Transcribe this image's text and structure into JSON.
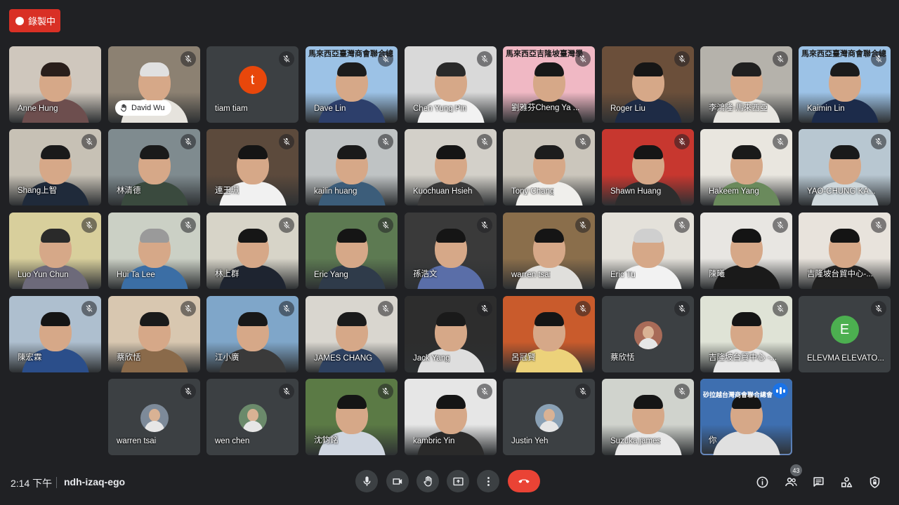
{
  "recording": {
    "label": "錄製中"
  },
  "participants": [
    {
      "name": "Anne Hung",
      "muted": false,
      "bg": "#cfc7bd",
      "shirt": "#6d4e4e",
      "hair": "#2a1f1b"
    },
    {
      "name": "David Wu",
      "muted": true,
      "bg": "#8c8172",
      "shirt": "#e6e3dd",
      "hair": "#e0e0e0",
      "hand_raised": true
    },
    {
      "name": "tiam tiam",
      "muted": true,
      "avatar": "t",
      "avatar_color": "#e8470b"
    },
    {
      "name": "Dave Lin",
      "muted": true,
      "bg": "#9cc2e6",
      "shirt": "#2d3f6b",
      "hair": "#1c1c1c",
      "banner": "馬來西亞臺灣商會聯合總"
    },
    {
      "name": "Chen Yung Pin",
      "muted": true,
      "bg": "#d9d9d9",
      "shirt": "#f2f2f2",
      "hair": "#2a2a2a"
    },
    {
      "name": "劉雅芬Cheng Ya ...",
      "muted": true,
      "bg": "#f0b8c4",
      "shirt": "#1f1f1f",
      "hair": "#181818",
      "banner": "馬來西亞吉隆坡臺灣學"
    },
    {
      "name": "Roger Liu",
      "muted": true,
      "bg": "#6b4f3a",
      "shirt": "#1e2b45",
      "hair": "#161616"
    },
    {
      "name": "李鴻隆-馬來西亞",
      "muted": true,
      "bg": "#b5b2ab",
      "shirt": "#e8e6e1",
      "hair": "#202020"
    },
    {
      "name": "Kaimin Lin",
      "muted": true,
      "bg": "#9cc2e6",
      "shirt": "#1c2b4a",
      "hair": "#1b1b1b",
      "banner": "馬來西亞臺灣商會聯合總"
    },
    {
      "name": "Shang上智",
      "muted": true,
      "bg": "#c7c1b5",
      "shirt": "#1f2a3a",
      "hair": "#1a1a1a"
    },
    {
      "name": "林清德",
      "muted": true,
      "bg": "#7f8b8f",
      "shirt": "#3a4a3e",
      "hair": "#1a1a1a"
    },
    {
      "name": "連玉珮",
      "muted": true,
      "bg": "#5c4a3c",
      "shirt": "#f1f1f1",
      "hair": "#151515"
    },
    {
      "name": "kailin huang",
      "muted": true,
      "bg": "#bfc3c4",
      "shirt": "#3c5d7a",
      "hair": "#1a1a1a"
    },
    {
      "name": "Kuochuan Hsieh",
      "muted": true,
      "bg": "#d3d0c9",
      "shirt": "#3a3a3a",
      "hair": "#151515"
    },
    {
      "name": "Tony Chang",
      "muted": true,
      "bg": "#cbc6bc",
      "shirt": "#f0efec",
      "hair": "#1d1d1d"
    },
    {
      "name": "Shawn Huang",
      "muted": true,
      "bg": "#c7372f",
      "shirt": "#2d2d2d",
      "hair": "#161616"
    },
    {
      "name": "Hakeem Yang",
      "muted": true,
      "bg": "#e9e6df",
      "shirt": "#6a8a5c",
      "hair": "#1a1a1a"
    },
    {
      "name": "YAO-CHUNG KA...",
      "muted": true,
      "bg": "#b8c7d1",
      "shirt": "#cfd8dc",
      "hair": "#1a1a1a"
    },
    {
      "name": "Luo Yun Chun",
      "muted": true,
      "bg": "#d8cf9c",
      "shirt": "#6d6a7a",
      "hair": "#2a2a2a"
    },
    {
      "name": "Hui Ta Lee",
      "muted": true,
      "bg": "#cbd0c5",
      "shirt": "#3b6ea5",
      "hair": "#9a9a9a"
    },
    {
      "name": "林上群",
      "muted": true,
      "bg": "#d7d4c8",
      "shirt": "#1e2430",
      "hair": "#161616"
    },
    {
      "name": "Eric Yang",
      "muted": true,
      "bg": "#5d7a52",
      "shirt": "#2f3b4a",
      "hair": "#151515"
    },
    {
      "name": "孫浩文",
      "muted": true,
      "bg": "#3a3a3a",
      "shirt": "#5a6ea8",
      "hair": "#151515"
    },
    {
      "name": "warren tsai",
      "muted": true,
      "bg": "#8a6e4b",
      "shirt": "#e0dfdc",
      "hair": "#151515"
    },
    {
      "name": "Eric Tu",
      "muted": true,
      "bg": "#e4e1da",
      "shirt": "#f2f2f2",
      "hair": "#cfcfcf"
    },
    {
      "name": "陳曦",
      "muted": true,
      "bg": "#e8e6e2",
      "shirt": "#1a1a1a",
      "hair": "#141414"
    },
    {
      "name": "吉隆坡台貿中心-...",
      "muted": true,
      "bg": "#e8e3dc",
      "shirt": "#222",
      "hair": "#141414"
    },
    {
      "name": "陳宏霖",
      "muted": true,
      "bg": "#aebfcf",
      "shirt": "#2b4e8a",
      "hair": "#151515"
    },
    {
      "name": "蔡欣恬",
      "muted": true,
      "bg": "#d8c7b0",
      "shirt": "#8a6a4a",
      "hair": "#1a1a1a"
    },
    {
      "name": "江小廣",
      "muted": true,
      "bg": "#7fa6c9",
      "shirt": "#3a3a3a",
      "hair": "#181818"
    },
    {
      "name": "JAMES CHANG",
      "muted": true,
      "bg": "#d9d6cf",
      "shirt": "#2e4160",
      "hair": "#1b1b1b"
    },
    {
      "name": "Jack Yang",
      "muted": true,
      "bg": "#2d2d2d",
      "shirt": "#dedede",
      "hair": "#1a1a1a"
    },
    {
      "name": "呂冠賢",
      "muted": true,
      "bg": "#c95b2c",
      "shirt": "#ecd27a",
      "hair": "#151515"
    },
    {
      "name": "蔡欣恬",
      "muted": true,
      "photo": true,
      "photo_color": "#a86b58"
    },
    {
      "name": "吉隆坡台貿中心 -...",
      "muted": true,
      "bg": "#dfe3d6",
      "shirt": "#e8e8e8",
      "hair": "#151515"
    },
    {
      "name": "ELEVMA ELEVATO...",
      "muted": true,
      "avatar": "E",
      "avatar_color": "#4caf50"
    },
    {
      "name": "warren tsai",
      "muted": true,
      "photo": true,
      "photo_color": "#7d8a99"
    },
    {
      "name": "wen chen",
      "muted": true,
      "photo": true,
      "photo_color": "#6b8a6b"
    },
    {
      "name": "沈鈞銘",
      "muted": true,
      "bg": "#5b7a45",
      "shirt": "#cfd6e0",
      "hair": "#151515"
    },
    {
      "name": "kambric Yin",
      "muted": true,
      "bg": "#e6e6e6",
      "shirt": "#2a2a2a",
      "hair": "#151515"
    },
    {
      "name": "Justin Yeh",
      "muted": true,
      "photo": true,
      "photo_color": "#8aa1b5"
    },
    {
      "name": "Suzuka james",
      "muted": true,
      "bg": "#d0d3cd",
      "shirt": "#e8e8e8",
      "hair": "#151515"
    },
    {
      "name": "你",
      "muted": false,
      "bg": "#3e6fb0",
      "shirt": "#e0e0e0",
      "hair": "#151515",
      "self": true,
      "speaking": true,
      "banner": "砂拉越台灣商會聯合總會"
    }
  ],
  "bottom_bar": {
    "time": "2:14 下午",
    "meeting_code": "ndh-izaq-ego",
    "participant_count": "43"
  },
  "colors": {
    "background": "#202124",
    "accent": "#8ab4f8",
    "hangup": "#ea4335",
    "record": "#d93025"
  },
  "icons": {
    "controls": [
      "mic-icon",
      "camera-icon",
      "raise-hand-icon",
      "present-icon",
      "more-options-icon",
      "hang-up-icon"
    ],
    "right": [
      "info-icon",
      "people-icon",
      "chat-icon",
      "activities-icon",
      "host-controls-icon"
    ]
  }
}
